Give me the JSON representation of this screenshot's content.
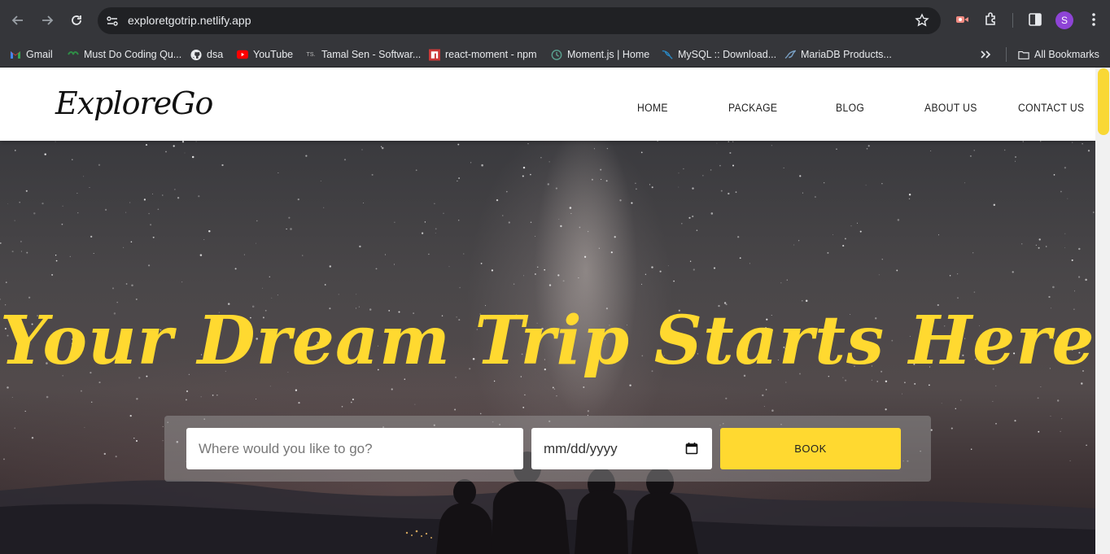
{
  "browser": {
    "url": "exploretgotrip.netlify.app",
    "profile_initial": "S",
    "bookmarks": [
      {
        "label": "Gmail",
        "icon": "gmail-icon"
      },
      {
        "label": "Must Do Coding Qu...",
        "icon": "gfg-icon"
      },
      {
        "label": "dsa",
        "icon": "github-icon"
      },
      {
        "label": "YouTube",
        "icon": "youtube-icon"
      },
      {
        "label": "Tamal Sen - Softwar...",
        "icon": "ts-icon"
      },
      {
        "label": "react-moment - npm",
        "icon": "npm-icon"
      },
      {
        "label": "Moment.js | Home",
        "icon": "moment-icon"
      },
      {
        "label": "MySQL :: Download...",
        "icon": "mysql-icon"
      },
      {
        "label": "MariaDB Products...",
        "icon": "mariadb-icon"
      }
    ],
    "all_bookmarks_label": "All Bookmarks"
  },
  "site": {
    "logo": "ExploreGo",
    "nav": [
      "HOME",
      "PACKAGE",
      "BLOG",
      "ABOUT US",
      "CONTACT US"
    ],
    "headline": "Your Dream Trip Starts Here!\"",
    "search": {
      "placeholder": "Where would you like to go?",
      "date_value": "mm/dd/yyyy",
      "book_label": "BOOK"
    }
  },
  "colors": {
    "accent": "#ffd930",
    "chrome_bg": "#35363a"
  }
}
